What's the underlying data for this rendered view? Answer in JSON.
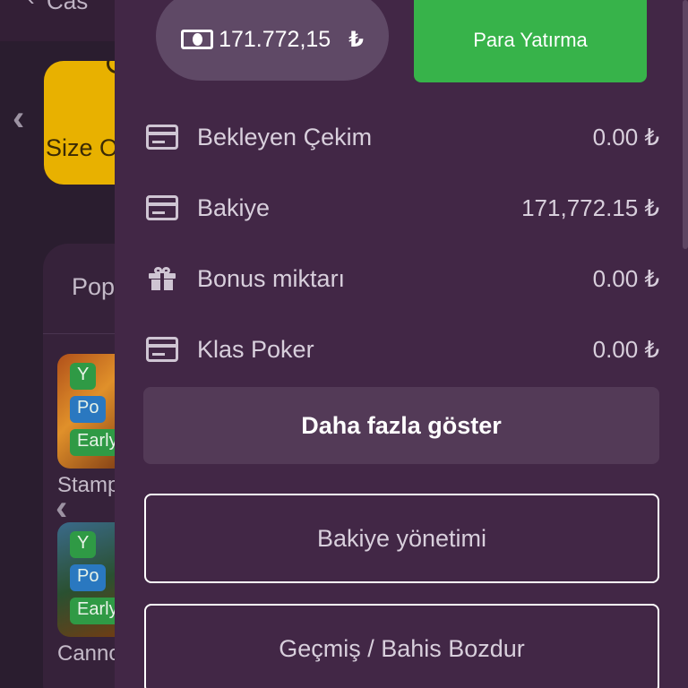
{
  "background": {
    "top_text": "Cas",
    "yellow_tile_text": "Size O",
    "panel_title": "Pop",
    "thumb1_tags": [
      "Y",
      "Po",
      "Early"
    ],
    "thumb2_tags": [
      "Y",
      "Po",
      "Early"
    ],
    "thumb1_caption": "Stamp",
    "thumb2_caption": "Canno"
  },
  "wallet": {
    "balance_amount": "171.772,15",
    "balance_currency": "₺",
    "deposit_label": "Para Yatırma",
    "rows": [
      {
        "icon": "card-icon",
        "label": "Bekleyen Çekim",
        "value": "0.00 ₺"
      },
      {
        "icon": "card-icon",
        "label": "Bakiye",
        "value": "171,772.15 ₺"
      },
      {
        "icon": "gift-icon",
        "label": "Bonus miktarı",
        "value": "0.00 ₺"
      },
      {
        "icon": "card-icon",
        "label": "Klas Poker",
        "value": "0.00 ₺"
      }
    ],
    "more_label": "Daha fazla göster",
    "balance_management_label": "Bakiye yönetimi",
    "history_label": "Geçmiş / Bahis Bozdur"
  },
  "colors": {
    "drawer_bg": "#422746",
    "deposit_green": "#37b34a",
    "pill_bg": "#5f4966"
  }
}
